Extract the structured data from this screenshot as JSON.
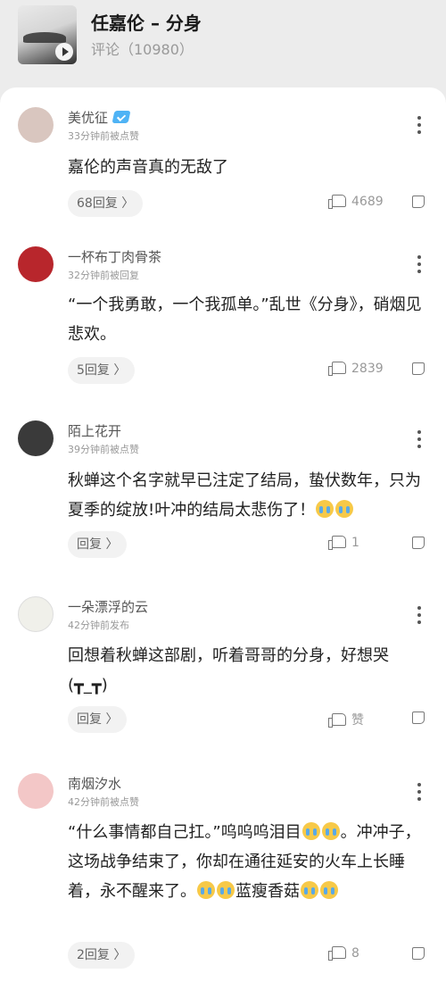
{
  "header": {
    "title": "任嘉伦 – 分身",
    "subtitle": "评论（10980）"
  },
  "comments": [
    {
      "name": "美优征",
      "time": "33分钟前被点赞",
      "text": "嘉伦的声音真的无敌了",
      "reply_label": "68回复 〉",
      "likes": "4689",
      "avatar_color": "#e8d8d0"
    },
    {
      "name": "一杯布丁肉骨茶",
      "time": "32分钟前被回复",
      "text": "“一个我勇敢，一个我孤单。”乱世《分身》，硝烟见悲欢。",
      "reply_label": "5回复 〉",
      "likes": "2839",
      "avatar_color": "#b8262c"
    },
    {
      "name": "陌上花开",
      "time": "39分钟前被点赞",
      "text": "秋蝉这个名字就早已注定了结局，蛰伏数年，只为夏季的绽放!叶冲的结局太悲伤了！",
      "reply_label": "回复 〉",
      "likes": "1",
      "avatar_color": "#3a3a3a"
    },
    {
      "name": "一朵漂浮的云",
      "time": "42分钟前发布",
      "text": "回想着秋蝉这部剧，听着哥哥的分身，好想哭(┳_┳)",
      "reply_label": "回复 〉",
      "likes": "赞",
      "avatar_color": "#f0f0ea"
    },
    {
      "name": "南烟汐水",
      "time": "42分钟前被点赞",
      "text_a": "“什么事情都自己扛。”呜呜呜泪目",
      "text_b": "。冲冲子，这场战争结束了，你却在通往延安的火车上长睡着，永不醒来了。",
      "text_c": "蓝瘦香菇",
      "reply_label": "2回复 〉",
      "likes": "8",
      "avatar_color": "#f3c7c7"
    }
  ],
  "icons": {
    "more": "more-vertical-icon",
    "like": "thumb-up-icon",
    "dislike": "thumb-down-icon",
    "verified": "verified-badge-icon",
    "play": "play-icon",
    "emoji": "crying-emoji-icon"
  }
}
